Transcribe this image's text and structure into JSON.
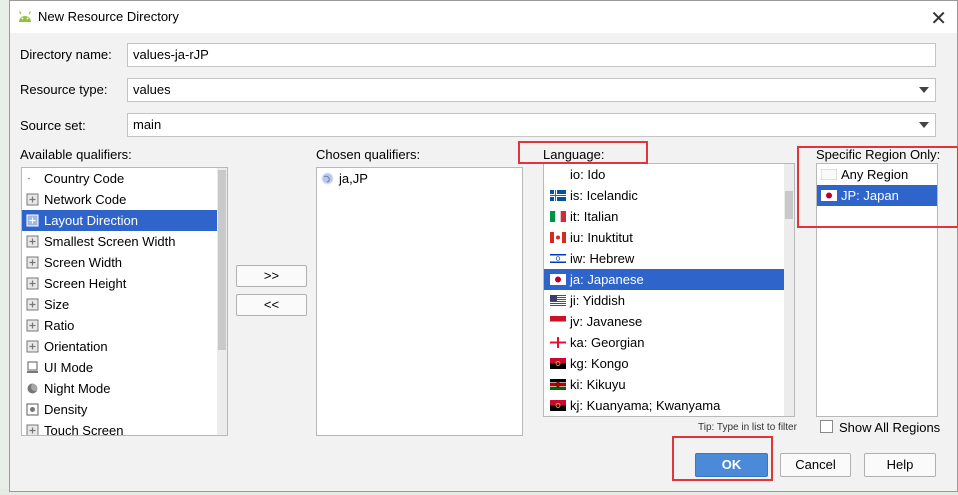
{
  "window": {
    "title": "New Resource Directory"
  },
  "form": {
    "directory_name_label": "Directory name:",
    "directory_name_value": "values-ja-rJP",
    "resource_type_label": "Resource type:",
    "resource_type_value": "values",
    "source_set_label": "Source set:",
    "source_set_value": "main"
  },
  "available": {
    "label": "Available qualifiers:",
    "items": [
      {
        "label": "Country Code",
        "icon": "dot-icon"
      },
      {
        "label": "Network Code",
        "icon": "network-code-icon"
      },
      {
        "label": "Layout Direction",
        "icon": "layout-direction-icon",
        "selected": true
      },
      {
        "label": "Smallest Screen Width",
        "icon": "smallest-width-icon"
      },
      {
        "label": "Screen Width",
        "icon": "screen-width-icon"
      },
      {
        "label": "Screen Height",
        "icon": "screen-height-icon"
      },
      {
        "label": "Size",
        "icon": "size-icon"
      },
      {
        "label": "Ratio",
        "icon": "ratio-icon"
      },
      {
        "label": "Orientation",
        "icon": "orientation-icon"
      },
      {
        "label": "UI Mode",
        "icon": "ui-mode-icon"
      },
      {
        "label": "Night Mode",
        "icon": "night-mode-icon"
      },
      {
        "label": "Density",
        "icon": "density-icon"
      },
      {
        "label": "Touch Screen",
        "icon": "touch-screen-icon"
      }
    ]
  },
  "transfer": {
    "add_label": ">>",
    "remove_label": "<<"
  },
  "chosen": {
    "label": "Chosen qualifiers:",
    "items": [
      {
        "label": "ja,JP",
        "icon": "globe-icon"
      }
    ]
  },
  "language": {
    "label": "Language:",
    "items": [
      {
        "label": "io: Ido",
        "flag": "none"
      },
      {
        "label": "is: Icelandic",
        "flag": "iceland-flag-icon"
      },
      {
        "label": "it: Italian",
        "flag": "italy-flag-icon"
      },
      {
        "label": "iu: Inuktitut",
        "flag": "canada-flag-icon"
      },
      {
        "label": "iw: Hebrew",
        "flag": "israel-flag-icon"
      },
      {
        "label": "ja: Japanese",
        "flag": "japan-flag-icon",
        "selected": true
      },
      {
        "label": "ji: Yiddish",
        "flag": "usa-flag-icon"
      },
      {
        "label": "jv: Javanese",
        "flag": "indonesia-flag-icon"
      },
      {
        "label": "ka: Georgian",
        "flag": "georgia-flag-icon"
      },
      {
        "label": "kg: Kongo",
        "flag": "angola-flag-icon"
      },
      {
        "label": "ki: Kikuyu",
        "flag": "kenya-flag-icon"
      },
      {
        "label": "kj: Kuanyama; Kwanyama",
        "flag": "angola-flag-icon"
      }
    ],
    "tip": "Tip: Type in list to filter"
  },
  "region": {
    "label": "Specific Region Only:",
    "items": [
      {
        "label": "Any Region",
        "flag": "blank-flag-icon"
      },
      {
        "label": "JP: Japan",
        "flag": "japan-flag-icon",
        "selected": true
      }
    ],
    "show_all_label": "Show All Regions"
  },
  "buttons": {
    "ok": "OK",
    "cancel": "Cancel",
    "help": "Help"
  },
  "colors": {
    "selection": "#2f65ca",
    "highlight_box": "#e0363b",
    "ok_button": "#4a8ad8"
  }
}
